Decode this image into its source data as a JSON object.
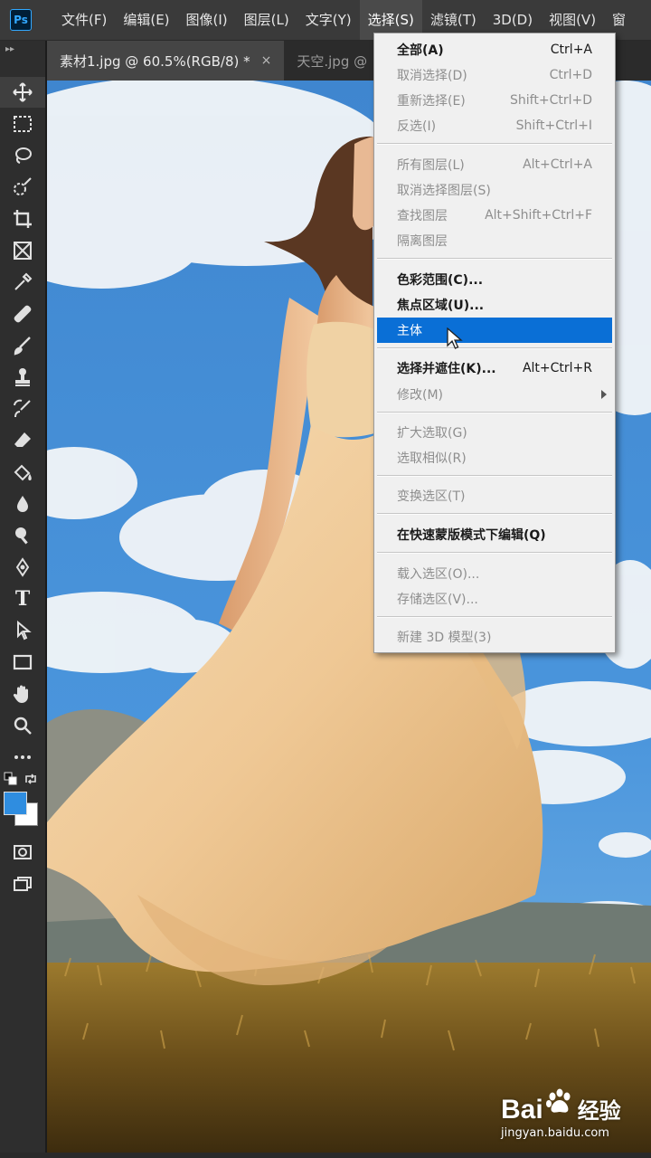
{
  "app": {
    "logo_text": "Ps"
  },
  "menubar": {
    "items": [
      {
        "label": "文件(F)"
      },
      {
        "label": "编辑(E)"
      },
      {
        "label": "图像(I)"
      },
      {
        "label": "图层(L)"
      },
      {
        "label": "文字(Y)"
      },
      {
        "label": "选择(S)",
        "active": true
      },
      {
        "label": "滤镜(T)"
      },
      {
        "label": "3D(D)"
      },
      {
        "label": "视图(V)"
      },
      {
        "label": "窗"
      }
    ]
  },
  "tabs": [
    {
      "label": "素材1.jpg @ 60.5%(RGB/8) *",
      "close": "×",
      "active": true
    },
    {
      "label": "天空.jpg @",
      "active": false
    }
  ],
  "toolbar": {
    "grip": "▸▸",
    "tools": [
      "move-icon",
      "marquee-icon",
      "lasso-icon",
      "quick-select-icon",
      "crop-icon",
      "frame-icon",
      "eyedropper-icon",
      "healing-icon",
      "brush-icon",
      "stamp-icon",
      "history-brush-icon",
      "eraser-icon",
      "paint-bucket-icon",
      "blur-icon",
      "dodge-icon",
      "pen-icon",
      "type-icon",
      "path-select-icon",
      "rectangle-icon",
      "hand-icon",
      "zoom-icon",
      "more-tools-icon"
    ],
    "text_tool_label": "T",
    "foreground_color": "#2f8de0",
    "background_color": "#ffffff"
  },
  "select_menu": {
    "items": [
      {
        "label": "全部(A)",
        "shortcut": "Ctrl+A",
        "state": "bold"
      },
      {
        "label": "取消选择(D)",
        "shortcut": "Ctrl+D",
        "state": "disabled"
      },
      {
        "label": "重新选择(E)",
        "shortcut": "Shift+Ctrl+D",
        "state": "disabled"
      },
      {
        "label": "反选(I)",
        "shortcut": "Shift+Ctrl+I",
        "state": "disabled"
      },
      {
        "label": "所有图层(L)",
        "shortcut": "Alt+Ctrl+A",
        "state": "disabled"
      },
      {
        "label": "取消选择图层(S)",
        "shortcut": "",
        "state": "disabled"
      },
      {
        "label": "查找图层",
        "shortcut": "Alt+Shift+Ctrl+F",
        "state": "disabled"
      },
      {
        "label": "隔离图层",
        "shortcut": "",
        "state": "disabled"
      },
      {
        "label": "色彩范围(C)...",
        "shortcut": "",
        "state": "bold"
      },
      {
        "label": "焦点区域(U)...",
        "shortcut": "",
        "state": "bold"
      },
      {
        "label": "主体",
        "shortcut": "",
        "state": "highlighted"
      },
      {
        "label": "选择并遮住(K)...",
        "shortcut": "Alt+Ctrl+R",
        "state": "bold"
      },
      {
        "label": "修改(M)",
        "shortcut": "",
        "state": "disabled",
        "submenu": true
      },
      {
        "label": "扩大选取(G)",
        "shortcut": "",
        "state": "disabled"
      },
      {
        "label": "选取相似(R)",
        "shortcut": "",
        "state": "disabled"
      },
      {
        "label": "变换选区(T)",
        "shortcut": "",
        "state": "disabled"
      },
      {
        "label": "在快速蒙版模式下编辑(Q)",
        "shortcut": "",
        "state": "bold"
      },
      {
        "label": "载入选区(O)...",
        "shortcut": "",
        "state": "disabled"
      },
      {
        "label": "存储选区(V)...",
        "shortcut": "",
        "state": "disabled"
      },
      {
        "label": "新建 3D 模型(3)",
        "shortcut": "",
        "state": "disabled"
      }
    ]
  },
  "watermark": {
    "brand_left": "Bai",
    "brand_right": "经验",
    "url": "jingyan.baidu.com"
  },
  "colors": {
    "highlight": "#0a6fd6",
    "menubar": "#3a3a3a",
    "sky": "#3c86d2"
  }
}
